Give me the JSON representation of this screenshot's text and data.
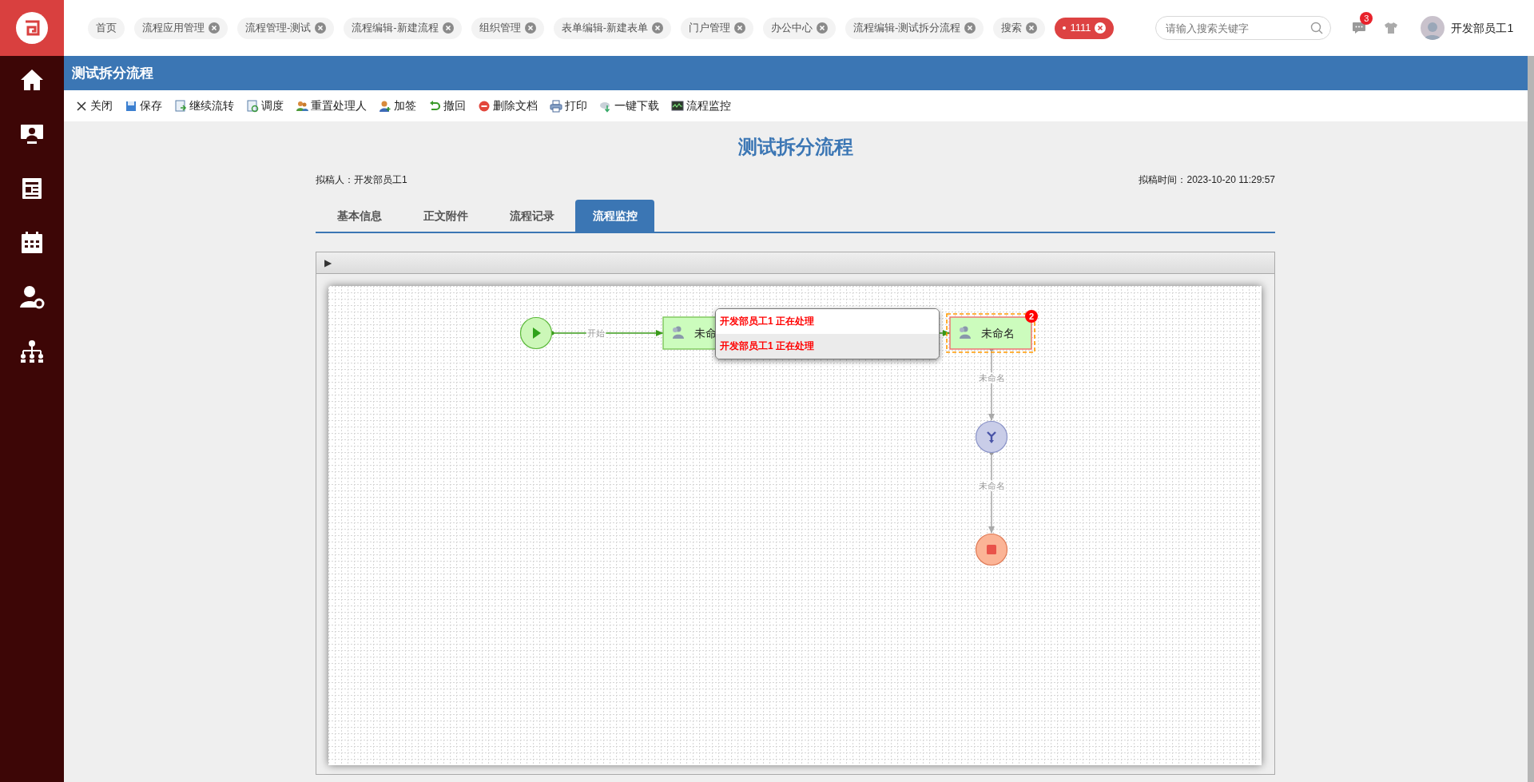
{
  "nav_tabs": [
    {
      "label": "首页",
      "closable": false,
      "selected": false
    },
    {
      "label": "流程应用管理",
      "closable": true,
      "selected": false
    },
    {
      "label": "流程管理-测试",
      "closable": true,
      "selected": false
    },
    {
      "label": "流程编辑-新建流程",
      "closable": true,
      "selected": false
    },
    {
      "label": "组织管理",
      "closable": true,
      "selected": false
    },
    {
      "label": "表单编辑-新建表单",
      "closable": true,
      "selected": false
    },
    {
      "label": "门户管理",
      "closable": true,
      "selected": false
    },
    {
      "label": "办公中心",
      "closable": true,
      "selected": false
    },
    {
      "label": "流程编辑-测试拆分流程",
      "closable": true,
      "selected": false
    },
    {
      "label": "搜索",
      "closable": true,
      "selected": false
    },
    {
      "label": "1111",
      "closable": true,
      "selected": true
    }
  ],
  "search": {
    "placeholder": "请输入搜索关键字"
  },
  "notifications": {
    "count": "3"
  },
  "user": {
    "name": "开发部员工1"
  },
  "sidebar": {
    "items": [
      {
        "kind": "home"
      },
      {
        "kind": "monitor"
      },
      {
        "kind": "news"
      },
      {
        "kind": "calendar"
      },
      {
        "kind": "user-settings"
      },
      {
        "kind": "org"
      }
    ]
  },
  "panel_title": "测试拆分流程",
  "toolbar": [
    {
      "label": "关闭",
      "kind": "close"
    },
    {
      "label": "保存",
      "kind": "save"
    },
    {
      "label": "继续流转",
      "kind": "forward"
    },
    {
      "label": "调度",
      "kind": "dispatch"
    },
    {
      "label": "重置处理人",
      "kind": "users"
    },
    {
      "label": "加签",
      "kind": "user-add"
    },
    {
      "label": "撤回",
      "kind": "undo"
    },
    {
      "label": "删除文档",
      "kind": "delete"
    },
    {
      "label": "打印",
      "kind": "print"
    },
    {
      "label": "一键下载",
      "kind": "download"
    },
    {
      "label": "流程监控",
      "kind": "monitor"
    }
  ],
  "form": {
    "title": "测试拆分流程",
    "drafter": "拟稿人：开发部员工1",
    "draft_time": "拟稿时间：2023-10-20 11:29:57"
  },
  "form_tabs": [
    {
      "label": "基本信息",
      "selected": false
    },
    {
      "label": "正文附件",
      "selected": false
    },
    {
      "label": "流程记录",
      "selected": false
    },
    {
      "label": "流程监控",
      "selected": true
    }
  ],
  "diagram": {
    "toggle": "▶",
    "nodes": [
      {
        "kind": "start"
      },
      {
        "kind": "task",
        "label": "未命",
        "highlighted": false
      },
      {
        "kind": "task",
        "label": "未命名",
        "highlighted": true,
        "badge": "2"
      },
      {
        "kind": "gateway"
      },
      {
        "kind": "end"
      }
    ],
    "edges": [
      {
        "label": "开始",
        "traversed": true
      },
      {
        "traversed": true
      },
      {
        "label": "未命名",
        "traversed": false
      },
      {
        "label": "未命名",
        "traversed": false
      }
    ],
    "tooltip": {
      "lines": [
        "开发部员工1 正在处理",
        "开发部员工1 正在处理"
      ]
    }
  }
}
